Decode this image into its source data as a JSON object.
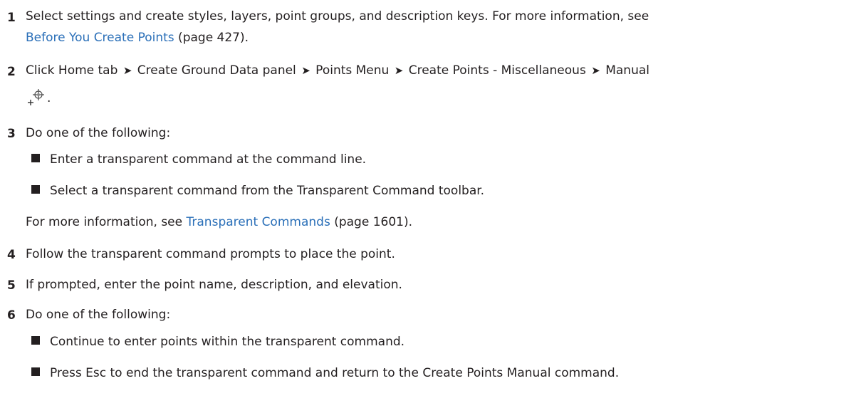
{
  "steps": [
    {
      "number": "1",
      "line1": "Select settings and create styles, layers, point groups, and description keys. For more information, see",
      "link": "Before You Create Points",
      "page_ref": " (page 427)."
    },
    {
      "number": "2",
      "parts": [
        "Click Home tab",
        "Create Ground Data panel",
        "Points Menu",
        "Create Points - Miscellaneous",
        "Manual"
      ],
      "arrow": "➤",
      "period": "."
    },
    {
      "number": "3",
      "text": "Do one of the following:",
      "bullets": [
        "Enter a transparent command at the command line.",
        "Select a transparent command from the Transparent Command toolbar."
      ],
      "note_prefix": "For more information, see ",
      "note_link": "Transparent Commands",
      "note_suffix": " (page 1601)."
    },
    {
      "number": "4",
      "text": "Follow the transparent command prompts to place the point."
    },
    {
      "number": "5",
      "text": "If prompted, enter the point name, description, and elevation."
    },
    {
      "number": "6",
      "text": "Do one of the following:",
      "bullets": [
        "Continue to enter points within the transparent command.",
        "Press Esc to end the transparent command and return to the Create Points Manual command."
      ]
    }
  ],
  "icons": {
    "manual": "create-point-manual-icon"
  },
  "colors": {
    "link": "#2a6fb8",
    "text": "#231f20"
  }
}
